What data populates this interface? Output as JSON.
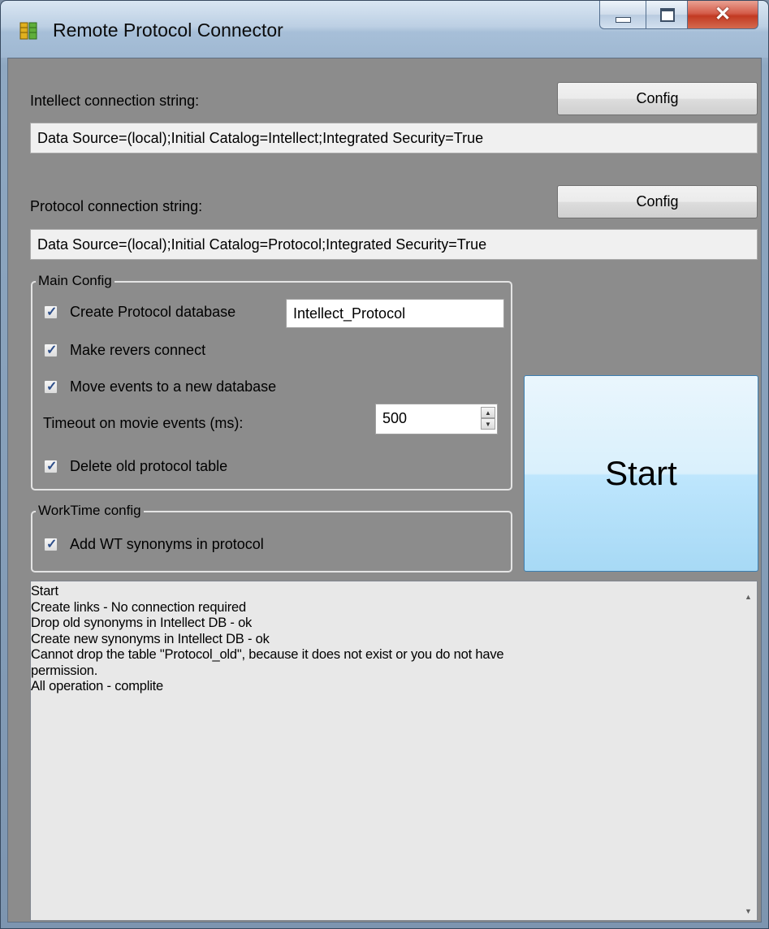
{
  "window": {
    "title": "Remote Protocol Connector"
  },
  "intellect": {
    "label": "Intellect connection string:",
    "config_label": "Config",
    "value": "Data Source=(local);Initial Catalog=Intellect;Integrated Security=True"
  },
  "protocol": {
    "label": "Protocol connection string:",
    "config_label": "Config",
    "value": "Data Source=(local);Initial Catalog=Protocol;Integrated Security=True"
  },
  "main_config": {
    "title": "Main Config",
    "create_db": {
      "label": "Create Protocol database",
      "checked": true,
      "db_name": "Intellect_Protocol"
    },
    "revers_connect": {
      "label": "Make revers connect",
      "checked": true
    },
    "move_events": {
      "label": "Move events to a new database",
      "checked": true
    },
    "timeout": {
      "label": "Timeout on movie events (ms):",
      "value": "500"
    },
    "delete_old": {
      "label": "Delete old protocol table",
      "checked": true
    }
  },
  "worktime_config": {
    "title": "WorkTime config",
    "add_wt": {
      "label": "Add WT synonyms in protocol",
      "checked": true
    }
  },
  "start_button": {
    "label": "Start"
  },
  "log": {
    "lines": [
      "Start",
      "Create links - No connection required",
      "Drop old synonyms in Intellect DB - ok",
      "Create new synonyms in Intellect DB - ok",
      "Cannot drop the table \"Protocol_old\", because it does not exist or you do not have",
      "permission.",
      "All operation - complite"
    ]
  },
  "colors": {
    "start_button": "#bee6fd",
    "client_bg": "#8c8c8c"
  },
  "icons": {
    "app": "database-icon",
    "minimize": "minimize-icon",
    "maximize": "maximize-icon",
    "close": "close-icon",
    "check": "checkmark-icon",
    "spin_up": "spin-up-icon",
    "spin_down": "spin-down-icon",
    "scroll_up": "scroll-up-icon",
    "scroll_down": "scroll-down-icon"
  }
}
